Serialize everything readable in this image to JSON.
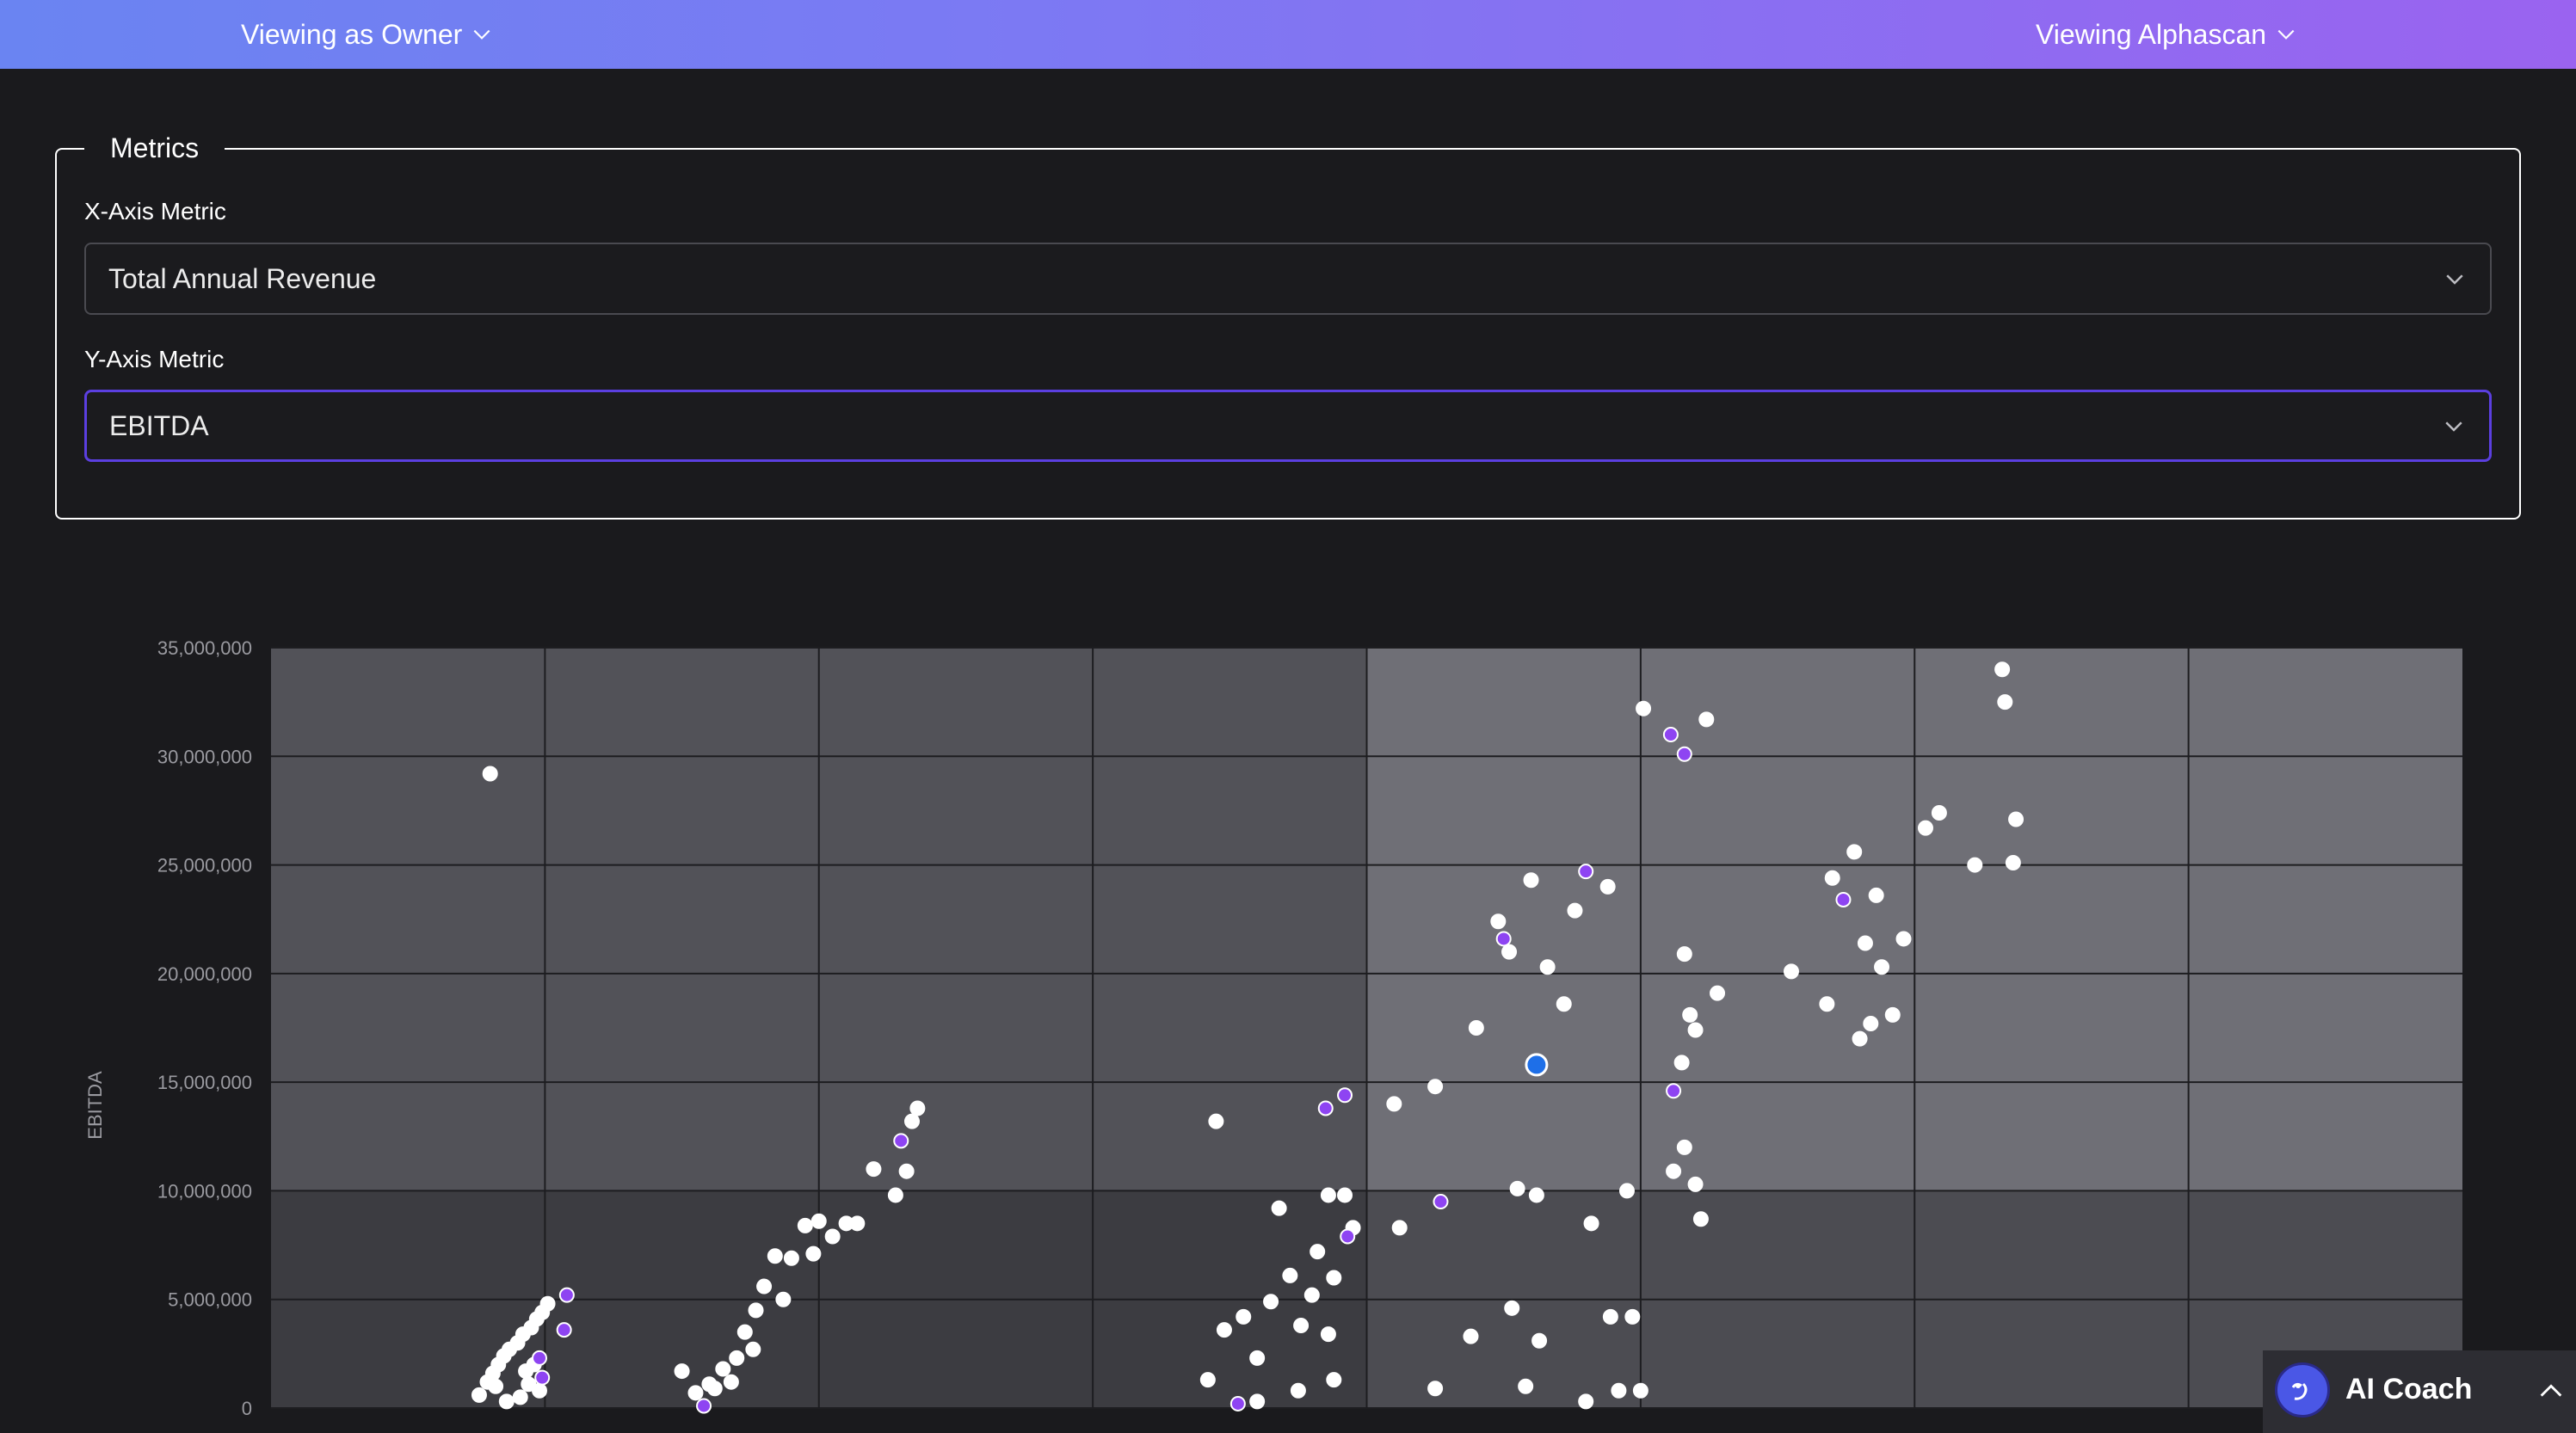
{
  "header": {
    "viewing_as": "Viewing as Owner",
    "viewing_company": "Viewing Alphascan"
  },
  "metrics": {
    "legend": "Metrics",
    "x_label": "X-Axis Metric",
    "x_value": "Total Annual Revenue",
    "y_label": "Y-Axis Metric",
    "y_value": "EBITDA"
  },
  "colors": {
    "accent": "#5b3fe0",
    "highlight_point": "#1e6fe8",
    "peer_point": "#8e44f2",
    "point": "#ffffff"
  },
  "chart_data": {
    "type": "scatter",
    "title": "",
    "xlabel": "",
    "ylabel": "EBITDA",
    "ylim": [
      0,
      35000000
    ],
    "yticks": [
      "35,000,000",
      "30,000,000",
      "25,000,000",
      "20,000,000",
      "15,000,000",
      "10,000,000",
      "5,000,000",
      "0"
    ],
    "grid": true,
    "x_columns": 8,
    "series": [
      {
        "category": "points",
        "color": "#ffffff",
        "points": [
          [
            0.8,
            29200000
          ],
          [
            0.76,
            600000
          ],
          [
            0.79,
            1200000
          ],
          [
            0.81,
            1600000
          ],
          [
            0.83,
            2000000
          ],
          [
            0.85,
            2400000
          ],
          [
            0.87,
            2700000
          ],
          [
            0.9,
            3000000
          ],
          [
            0.92,
            3400000
          ],
          [
            0.95,
            3700000
          ],
          [
            0.97,
            4100000
          ],
          [
            0.99,
            4400000
          ],
          [
            1.01,
            4800000
          ],
          [
            0.94,
            1100000
          ],
          [
            0.98,
            800000
          ],
          [
            0.91,
            500000
          ],
          [
            0.86,
            300000
          ],
          [
            0.96,
            2000000
          ],
          [
            0.93,
            1700000
          ],
          [
            0.82,
            1000000
          ],
          [
            1.5,
            1700000
          ],
          [
            1.55,
            700000
          ],
          [
            1.6,
            1100000
          ],
          [
            1.65,
            1800000
          ],
          [
            1.7,
            2300000
          ],
          [
            1.73,
            3500000
          ],
          [
            1.77,
            4500000
          ],
          [
            1.8,
            5600000
          ],
          [
            1.84,
            7000000
          ],
          [
            1.9,
            6900000
          ],
          [
            1.95,
            8400000
          ],
          [
            2.0,
            8600000
          ],
          [
            2.05,
            7900000
          ],
          [
            2.1,
            8500000
          ],
          [
            2.2,
            11000000
          ],
          [
            2.28,
            9800000
          ],
          [
            2.32,
            10900000
          ],
          [
            2.34,
            13200000
          ],
          [
            2.36,
            13800000
          ],
          [
            1.87,
            5000000
          ],
          [
            1.62,
            900000
          ],
          [
            1.68,
            1200000
          ],
          [
            1.76,
            2700000
          ],
          [
            1.98,
            7100000
          ],
          [
            2.14,
            8500000
          ],
          [
            3.45,
            13200000
          ],
          [
            3.42,
            1300000
          ],
          [
            3.48,
            3600000
          ],
          [
            3.55,
            4200000
          ],
          [
            3.6,
            2300000
          ],
          [
            3.65,
            4900000
          ],
          [
            3.68,
            9200000
          ],
          [
            3.72,
            6100000
          ],
          [
            3.76,
            3800000
          ],
          [
            3.8,
            5200000
          ],
          [
            3.82,
            7200000
          ],
          [
            3.86,
            9800000
          ],
          [
            3.88,
            6000000
          ],
          [
            3.92,
            9800000
          ],
          [
            3.95,
            8300000
          ],
          [
            3.6,
            300000
          ],
          [
            3.75,
            800000
          ],
          [
            3.88,
            1300000
          ],
          [
            3.86,
            3400000
          ],
          [
            4.1,
            14000000
          ],
          [
            4.25,
            14800000
          ],
          [
            4.4,
            17500000
          ],
          [
            4.48,
            22400000
          ],
          [
            4.52,
            21000000
          ],
          [
            4.12,
            8300000
          ],
          [
            4.38,
            3300000
          ],
          [
            4.25,
            900000
          ],
          [
            4.6,
            24300000
          ],
          [
            4.66,
            20300000
          ],
          [
            4.72,
            18600000
          ],
          [
            4.76,
            22900000
          ],
          [
            4.82,
            8500000
          ],
          [
            4.88,
            24000000
          ],
          [
            4.95,
            10000000
          ],
          [
            4.55,
            10100000
          ],
          [
            4.62,
            9800000
          ],
          [
            4.53,
            4600000
          ],
          [
            4.58,
            1000000
          ],
          [
            4.63,
            3100000
          ],
          [
            4.89,
            4200000
          ],
          [
            4.92,
            800000
          ],
          [
            4.97,
            4200000
          ],
          [
            5.01,
            32200000
          ],
          [
            5.24,
            31700000
          ],
          [
            5.16,
            20900000
          ],
          [
            5.18,
            18100000
          ],
          [
            5.2,
            17400000
          ],
          [
            5.15,
            15900000
          ],
          [
            5.12,
            10900000
          ],
          [
            5.16,
            12000000
          ],
          [
            5.2,
            10300000
          ],
          [
            5.22,
            8700000
          ],
          [
            5.0,
            800000
          ],
          [
            4.8,
            300000
          ],
          [
            5.28,
            19100000
          ],
          [
            5.55,
            20100000
          ],
          [
            5.68,
            18600000
          ],
          [
            5.7,
            24400000
          ],
          [
            5.78,
            25600000
          ],
          [
            5.82,
            21400000
          ],
          [
            5.86,
            23600000
          ],
          [
            5.88,
            20300000
          ],
          [
            5.92,
            18100000
          ],
          [
            5.96,
            21600000
          ],
          [
            6.04,
            26700000
          ],
          [
            6.09,
            27400000
          ],
          [
            6.22,
            25000000
          ],
          [
            6.32,
            34000000
          ],
          [
            6.33,
            32500000
          ],
          [
            6.37,
            27100000
          ],
          [
            6.36,
            25100000
          ],
          [
            5.8,
            17000000
          ],
          [
            5.84,
            17700000
          ]
        ]
      },
      {
        "category": "peer",
        "color": "#8e44f2",
        "points": [
          [
            1.08,
            5200000
          ],
          [
            1.07,
            3600000
          ],
          [
            0.99,
            1400000
          ],
          [
            0.98,
            2300000
          ],
          [
            1.58,
            100000
          ],
          [
            2.3,
            12300000
          ],
          [
            3.85,
            13800000
          ],
          [
            3.92,
            14400000
          ],
          [
            3.93,
            7900000
          ],
          [
            4.27,
            9500000
          ],
          [
            4.5,
            21600000
          ],
          [
            4.8,
            24700000
          ],
          [
            5.11,
            31000000
          ],
          [
            5.16,
            30100000
          ],
          [
            5.12,
            14600000
          ],
          [
            5.74,
            23400000
          ],
          [
            3.53,
            200000
          ]
        ]
      },
      {
        "category": "self",
        "color": "#1e6fe8",
        "points": [
          [
            4.62,
            15800000
          ]
        ]
      }
    ]
  },
  "coach": {
    "label": "AI Coach"
  }
}
